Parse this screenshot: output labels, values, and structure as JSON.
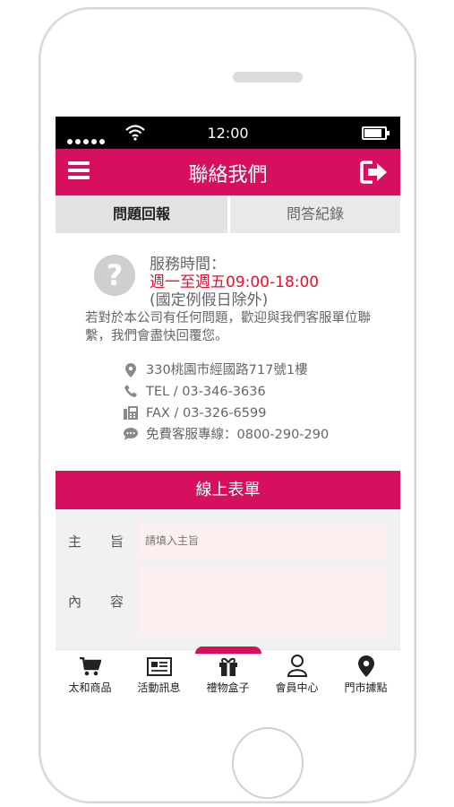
{
  "status_bar": {
    "time": "12:00",
    "signal_icon": "signal-dots-icon",
    "wifi_icon": "wifi-icon",
    "battery_icon": "battery-icon",
    "battery_level": 0.85
  },
  "header": {
    "title": "聯絡我們",
    "menu_icon": "hamburger-menu-icon",
    "logout_icon": "logout-icon",
    "accent": "#d6105e"
  },
  "tabs": [
    {
      "label": "問題回報",
      "active": true
    },
    {
      "label": "問答紀錄",
      "active": false
    }
  ],
  "service": {
    "icon": "question-circle-icon",
    "label": "服務時間：",
    "hours": "週一至週五09:00-18:00",
    "note": "(國定例假日除外)",
    "hours_color": "#e8102f",
    "description": "若對於本公司有任何問題，歡迎與我們客服單位聯繫，我們會盡快回覆您。"
  },
  "contacts": [
    {
      "icon": "map-pin-icon",
      "text": "330桃園市經國路717號1樓"
    },
    {
      "icon": "phone-icon",
      "text": "TEL / 03-346-3636"
    },
    {
      "icon": "fax-icon",
      "text": "FAX / 03-326-6599"
    },
    {
      "icon": "chat-icon",
      "text": "免費客服專線：0800-290-290"
    }
  ],
  "form": {
    "title": "線上表單",
    "subject_label_a": "主",
    "subject_label_b": "旨",
    "subject_placeholder": "請填入主旨",
    "subject_value": "",
    "content_label_a": "內",
    "content_label_b": "容",
    "content_value": ""
  },
  "bottom_nav": [
    {
      "label": "太和商品",
      "icon": "cart-icon"
    },
    {
      "label": "活動訊息",
      "icon": "newspaper-icon"
    },
    {
      "label": "禮物盒子",
      "icon": "gift-icon"
    },
    {
      "label": "會員中心",
      "icon": "user-icon"
    },
    {
      "label": "門市據點",
      "icon": "location-pin-icon"
    }
  ]
}
